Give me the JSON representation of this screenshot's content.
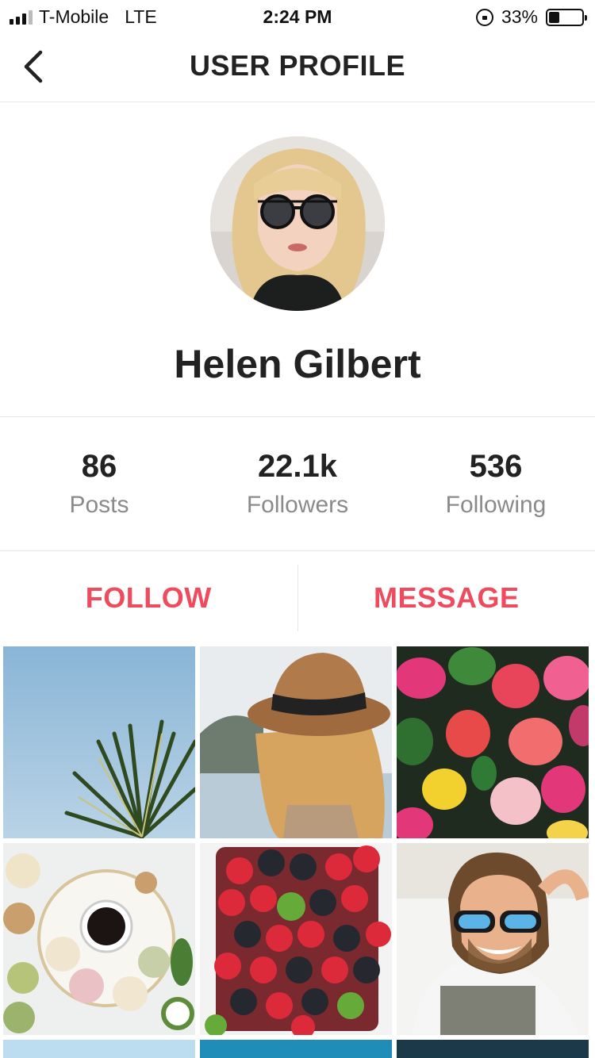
{
  "status_bar": {
    "carrier": "T-Mobile",
    "network": "LTE",
    "time": "2:24 PM",
    "battery_text": "33%",
    "battery_level": 0.33
  },
  "header": {
    "title": "USER PROFILE",
    "back_icon": "chevron-left-icon"
  },
  "profile": {
    "name": "Helen Gilbert"
  },
  "stats": [
    {
      "value": "86",
      "label": "Posts"
    },
    {
      "value": "22.1k",
      "label": "Followers"
    },
    {
      "value": "536",
      "label": "Following"
    }
  ],
  "actions": {
    "follow_label": "FOLLOW",
    "message_label": "MESSAGE",
    "accent_color": "#ef4b5f"
  },
  "gallery": {
    "photos": [
      "palm-tree-sky",
      "woman-with-hat",
      "tulips",
      "macarons-coffee",
      "berries",
      "man-with-sunglasses",
      "ocean",
      "sea",
      "dark-scene"
    ]
  }
}
